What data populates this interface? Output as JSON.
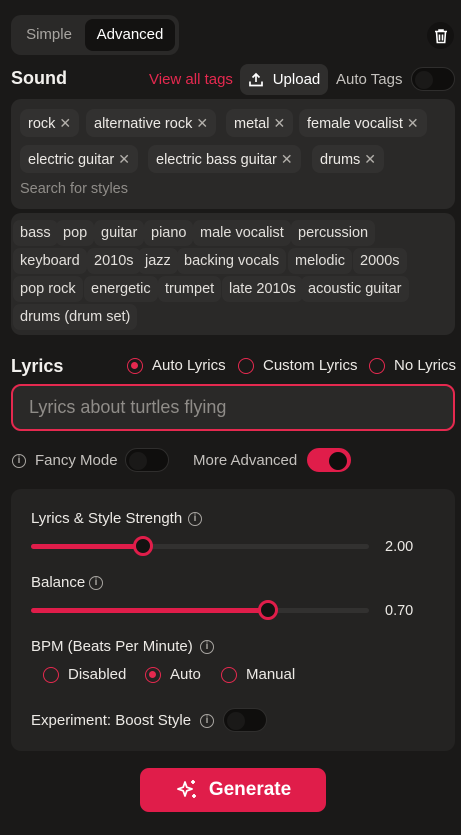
{
  "mode": {
    "simple": "Simple",
    "advanced": "Advanced"
  },
  "sound": {
    "title": "Sound",
    "view_all_tags": "View all tags",
    "upload": "Upload",
    "auto_tags": "Auto Tags",
    "selected_tags": [
      "rock",
      "alternative rock",
      "metal",
      "female vocalist",
      "electric guitar",
      "electric bass guitar",
      "drums"
    ],
    "search_placeholder": "Search for styles",
    "suggested_tags": [
      "bass",
      "pop",
      "guitar",
      "piano",
      "male vocalist",
      "percussion",
      "keyboard",
      "2010s",
      "jazz",
      "backing vocals",
      "melodic",
      "2000s",
      "pop rock",
      "energetic",
      "trumpet",
      "late 2010s",
      "acoustic guitar",
      "drums (drum set)"
    ]
  },
  "lyrics": {
    "title": "Lyrics",
    "options": [
      "Auto Lyrics",
      "Custom Lyrics",
      "No Lyrics"
    ],
    "selected": "Auto Lyrics",
    "placeholder": "Lyrics about turtles flying",
    "value": ""
  },
  "fancy_mode": {
    "label": "Fancy Mode",
    "on": false
  },
  "more_advanced": {
    "label": "More Advanced",
    "on": true
  },
  "advanced": {
    "style_strength": {
      "label": "Lyrics & Style Strength",
      "value": "2.00",
      "fraction": 0.33
    },
    "balance": {
      "label": "Balance",
      "value": "0.70",
      "fraction": 0.7
    },
    "bpm": {
      "label": "BPM (Beats Per Minute)",
      "options": [
        "Disabled",
        "Auto",
        "Manual"
      ],
      "selected": "Auto"
    },
    "boost_style": {
      "label": "Experiment: Boost Style",
      "on": false
    }
  },
  "generate": "Generate",
  "colors": {
    "accent": "#e01d4a",
    "background": "#1a1918",
    "panel": "#2a2928"
  }
}
